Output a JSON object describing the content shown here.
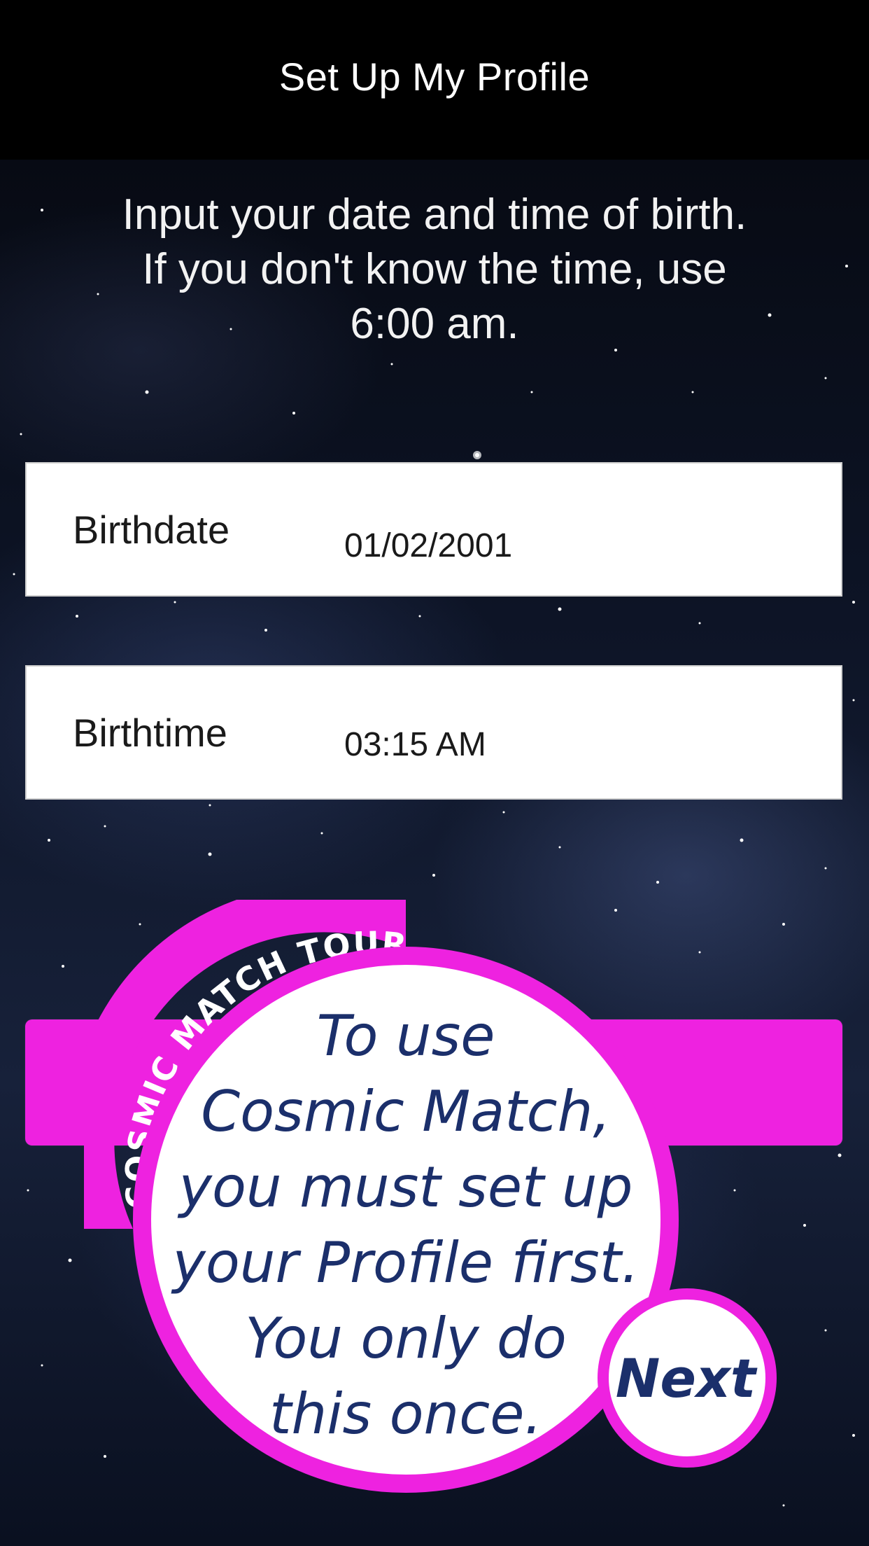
{
  "header": {
    "title": "Set Up My Profile"
  },
  "instructions": {
    "line1": "Input your date and time of birth.",
    "line2": "If you don't know the time, use",
    "line3": "6:00 am."
  },
  "fields": {
    "birthdate": {
      "label": "Birthdate",
      "value": "01/02/2001"
    },
    "birthtime": {
      "label": "Birthtime",
      "value": "03:15 AM"
    }
  },
  "tour": {
    "ribbon_text": "COSMIC MATCH TOUR",
    "message_lines": [
      "To use",
      "Cosmic Match,",
      "you must set up",
      "your Profile first.",
      "You only do",
      "this once."
    ],
    "next_label": "Next"
  },
  "colors": {
    "accent_pink": "#ee22e0",
    "text_navy": "#1b2f6b",
    "header_bg": "#000000"
  }
}
